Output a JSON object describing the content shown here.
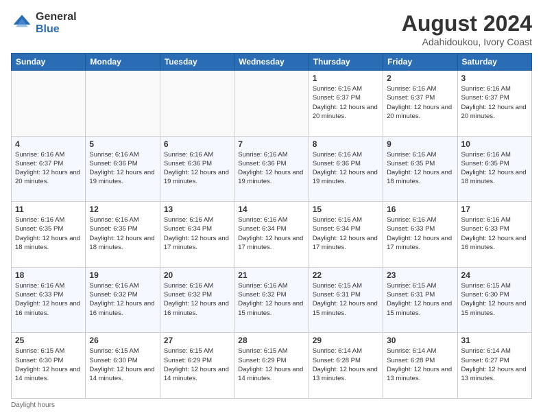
{
  "logo": {
    "general": "General",
    "blue": "Blue"
  },
  "title": "August 2024",
  "subtitle": "Adahidoukou, Ivory Coast",
  "weekdays": [
    "Sunday",
    "Monday",
    "Tuesday",
    "Wednesday",
    "Thursday",
    "Friday",
    "Saturday"
  ],
  "footer": "Daylight hours",
  "weeks": [
    [
      {
        "day": "",
        "sunrise": "",
        "sunset": "",
        "daylight": ""
      },
      {
        "day": "",
        "sunrise": "",
        "sunset": "",
        "daylight": ""
      },
      {
        "day": "",
        "sunrise": "",
        "sunset": "",
        "daylight": ""
      },
      {
        "day": "",
        "sunrise": "",
        "sunset": "",
        "daylight": ""
      },
      {
        "day": "1",
        "sunrise": "Sunrise: 6:16 AM",
        "sunset": "Sunset: 6:37 PM",
        "daylight": "Daylight: 12 hours and 20 minutes."
      },
      {
        "day": "2",
        "sunrise": "Sunrise: 6:16 AM",
        "sunset": "Sunset: 6:37 PM",
        "daylight": "Daylight: 12 hours and 20 minutes."
      },
      {
        "day": "3",
        "sunrise": "Sunrise: 6:16 AM",
        "sunset": "Sunset: 6:37 PM",
        "daylight": "Daylight: 12 hours and 20 minutes."
      }
    ],
    [
      {
        "day": "4",
        "sunrise": "Sunrise: 6:16 AM",
        "sunset": "Sunset: 6:37 PM",
        "daylight": "Daylight: 12 hours and 20 minutes."
      },
      {
        "day": "5",
        "sunrise": "Sunrise: 6:16 AM",
        "sunset": "Sunset: 6:36 PM",
        "daylight": "Daylight: 12 hours and 19 minutes."
      },
      {
        "day": "6",
        "sunrise": "Sunrise: 6:16 AM",
        "sunset": "Sunset: 6:36 PM",
        "daylight": "Daylight: 12 hours and 19 minutes."
      },
      {
        "day": "7",
        "sunrise": "Sunrise: 6:16 AM",
        "sunset": "Sunset: 6:36 PM",
        "daylight": "Daylight: 12 hours and 19 minutes."
      },
      {
        "day": "8",
        "sunrise": "Sunrise: 6:16 AM",
        "sunset": "Sunset: 6:36 PM",
        "daylight": "Daylight: 12 hours and 19 minutes."
      },
      {
        "day": "9",
        "sunrise": "Sunrise: 6:16 AM",
        "sunset": "Sunset: 6:35 PM",
        "daylight": "Daylight: 12 hours and 18 minutes."
      },
      {
        "day": "10",
        "sunrise": "Sunrise: 6:16 AM",
        "sunset": "Sunset: 6:35 PM",
        "daylight": "Daylight: 12 hours and 18 minutes."
      }
    ],
    [
      {
        "day": "11",
        "sunrise": "Sunrise: 6:16 AM",
        "sunset": "Sunset: 6:35 PM",
        "daylight": "Daylight: 12 hours and 18 minutes."
      },
      {
        "day": "12",
        "sunrise": "Sunrise: 6:16 AM",
        "sunset": "Sunset: 6:35 PM",
        "daylight": "Daylight: 12 hours and 18 minutes."
      },
      {
        "day": "13",
        "sunrise": "Sunrise: 6:16 AM",
        "sunset": "Sunset: 6:34 PM",
        "daylight": "Daylight: 12 hours and 17 minutes."
      },
      {
        "day": "14",
        "sunrise": "Sunrise: 6:16 AM",
        "sunset": "Sunset: 6:34 PM",
        "daylight": "Daylight: 12 hours and 17 minutes."
      },
      {
        "day": "15",
        "sunrise": "Sunrise: 6:16 AM",
        "sunset": "Sunset: 6:34 PM",
        "daylight": "Daylight: 12 hours and 17 minutes."
      },
      {
        "day": "16",
        "sunrise": "Sunrise: 6:16 AM",
        "sunset": "Sunset: 6:33 PM",
        "daylight": "Daylight: 12 hours and 17 minutes."
      },
      {
        "day": "17",
        "sunrise": "Sunrise: 6:16 AM",
        "sunset": "Sunset: 6:33 PM",
        "daylight": "Daylight: 12 hours and 16 minutes."
      }
    ],
    [
      {
        "day": "18",
        "sunrise": "Sunrise: 6:16 AM",
        "sunset": "Sunset: 6:33 PM",
        "daylight": "Daylight: 12 hours and 16 minutes."
      },
      {
        "day": "19",
        "sunrise": "Sunrise: 6:16 AM",
        "sunset": "Sunset: 6:32 PM",
        "daylight": "Daylight: 12 hours and 16 minutes."
      },
      {
        "day": "20",
        "sunrise": "Sunrise: 6:16 AM",
        "sunset": "Sunset: 6:32 PM",
        "daylight": "Daylight: 12 hours and 16 minutes."
      },
      {
        "day": "21",
        "sunrise": "Sunrise: 6:16 AM",
        "sunset": "Sunset: 6:32 PM",
        "daylight": "Daylight: 12 hours and 15 minutes."
      },
      {
        "day": "22",
        "sunrise": "Sunrise: 6:15 AM",
        "sunset": "Sunset: 6:31 PM",
        "daylight": "Daylight: 12 hours and 15 minutes."
      },
      {
        "day": "23",
        "sunrise": "Sunrise: 6:15 AM",
        "sunset": "Sunset: 6:31 PM",
        "daylight": "Daylight: 12 hours and 15 minutes."
      },
      {
        "day": "24",
        "sunrise": "Sunrise: 6:15 AM",
        "sunset": "Sunset: 6:30 PM",
        "daylight": "Daylight: 12 hours and 15 minutes."
      }
    ],
    [
      {
        "day": "25",
        "sunrise": "Sunrise: 6:15 AM",
        "sunset": "Sunset: 6:30 PM",
        "daylight": "Daylight: 12 hours and 14 minutes."
      },
      {
        "day": "26",
        "sunrise": "Sunrise: 6:15 AM",
        "sunset": "Sunset: 6:30 PM",
        "daylight": "Daylight: 12 hours and 14 minutes."
      },
      {
        "day": "27",
        "sunrise": "Sunrise: 6:15 AM",
        "sunset": "Sunset: 6:29 PM",
        "daylight": "Daylight: 12 hours and 14 minutes."
      },
      {
        "day": "28",
        "sunrise": "Sunrise: 6:15 AM",
        "sunset": "Sunset: 6:29 PM",
        "daylight": "Daylight: 12 hours and 14 minutes."
      },
      {
        "day": "29",
        "sunrise": "Sunrise: 6:14 AM",
        "sunset": "Sunset: 6:28 PM",
        "daylight": "Daylight: 12 hours and 13 minutes."
      },
      {
        "day": "30",
        "sunrise": "Sunrise: 6:14 AM",
        "sunset": "Sunset: 6:28 PM",
        "daylight": "Daylight: 12 hours and 13 minutes."
      },
      {
        "day": "31",
        "sunrise": "Sunrise: 6:14 AM",
        "sunset": "Sunset: 6:27 PM",
        "daylight": "Daylight: 12 hours and 13 minutes."
      }
    ]
  ]
}
